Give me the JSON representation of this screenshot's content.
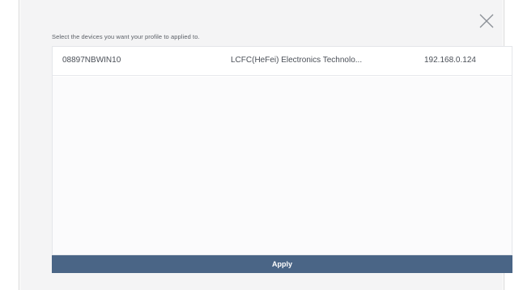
{
  "dialog": {
    "instruction": "Select the devices you want your profile to applied to.",
    "close_icon": "close-icon",
    "devices": [
      {
        "name": "08897NBWIN10",
        "vendor": "LCFC(HeFei) Electronics Technolo...",
        "ip": "192.168.0.124"
      }
    ],
    "apply_label": "Apply"
  },
  "colors": {
    "apply_button": "#4a6586",
    "dialog_background": "#f4f4f5",
    "text": "#4a4f57"
  }
}
